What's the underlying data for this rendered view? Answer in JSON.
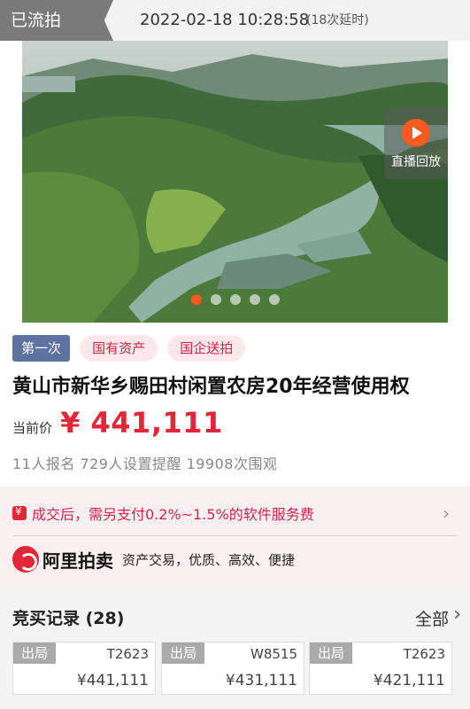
{
  "header": {
    "status": "已流拍",
    "end_time": "2022-02-18 10:28:58",
    "delay_note": "(18次延时)"
  },
  "banner": {
    "live_replay_label": "直播回放",
    "slide_count": 5,
    "active_slide": 1
  },
  "tags": [
    "第一次",
    "国有资产",
    "国企送拍"
  ],
  "title": "黄山市新华乡赐田村闲置农房20年经营使用权",
  "price": {
    "label": "当前价",
    "value": "¥ 441,111"
  },
  "stats": "11人报名  729人设置提醒  19908次围观",
  "service_fee": {
    "text": "成交后，需另支付0.2%~1.5%的软件服务费"
  },
  "brand": {
    "name": "阿里拍卖",
    "slogan": "资产交易，优质、高效、便捷"
  },
  "records": {
    "title": "竞买记录 (28)",
    "all_label": "全部",
    "bids": [
      {
        "status": "出局",
        "user": "T2623",
        "amount": "¥441,111"
      },
      {
        "status": "出局",
        "user": "W8515",
        "amount": "¥431,111"
      },
      {
        "status": "出局",
        "user": "T2623",
        "amount": "¥421,111"
      }
    ]
  },
  "colors": {
    "accent": "#e32638",
    "tag_blue": "#5f73a1",
    "live_orange": "#ff5a1f"
  }
}
